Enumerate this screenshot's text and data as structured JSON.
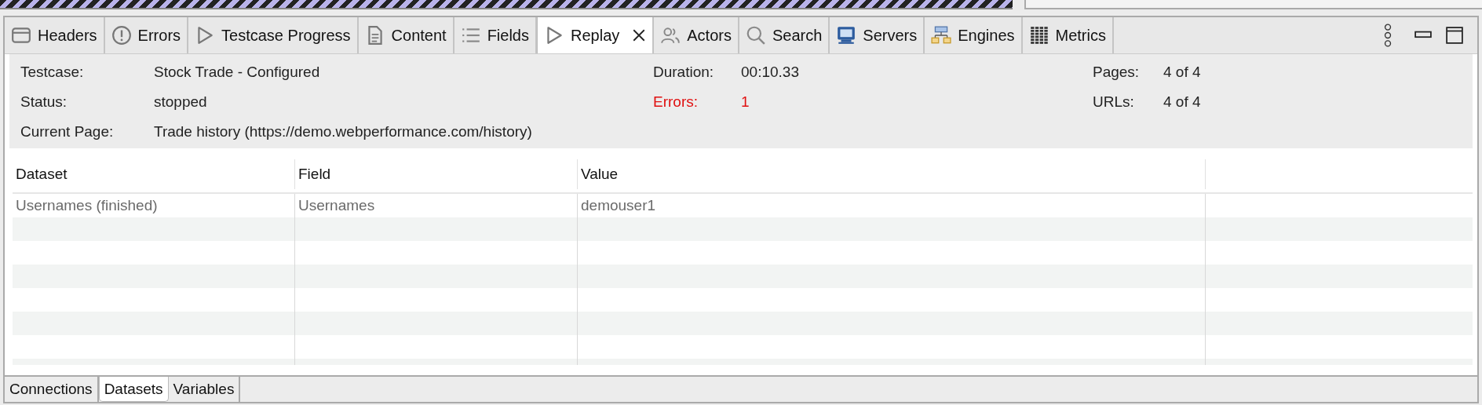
{
  "tabs": [
    {
      "label": "Headers",
      "selected": false
    },
    {
      "label": "Errors",
      "selected": false
    },
    {
      "label": "Testcase Progress",
      "selected": false
    },
    {
      "label": "Content",
      "selected": false
    },
    {
      "label": "Fields",
      "selected": false
    },
    {
      "label": "Replay",
      "selected": true,
      "closable": true
    },
    {
      "label": "Actors",
      "selected": false
    },
    {
      "label": "Search",
      "selected": false
    },
    {
      "label": "Servers",
      "selected": false
    },
    {
      "label": "Engines",
      "selected": false
    },
    {
      "label": "Metrics",
      "selected": false
    }
  ],
  "summary": {
    "columns": [
      [
        {
          "label": "Testcase:",
          "value": "Stock Trade - Configured",
          "alert": false
        },
        {
          "label": "Status:",
          "value": "stopped",
          "alert": false
        },
        {
          "label": "Current Page:",
          "value": "Trade history (https://demo.webperformance.com/history)",
          "alert": false
        }
      ],
      [
        {
          "label": "Duration:",
          "value": "00:10.33",
          "alert": false
        },
        {
          "label": "Errors:",
          "value": "1",
          "alert": true
        }
      ],
      [
        {
          "label": "Pages:",
          "value": "4 of 4",
          "alert": false
        },
        {
          "label": "URLs:",
          "value": "4 of 4",
          "alert": false
        }
      ]
    ]
  },
  "table": {
    "columns": [
      "Dataset",
      "Field",
      "Value"
    ],
    "rows": [
      [
        "Usernames (finished)",
        "Usernames",
        "demouser1"
      ]
    ]
  },
  "bottom_tabs": [
    {
      "label": "Connections",
      "selected": false
    },
    {
      "label": "Datasets",
      "selected": true
    },
    {
      "label": "Variables",
      "selected": false
    }
  ]
}
